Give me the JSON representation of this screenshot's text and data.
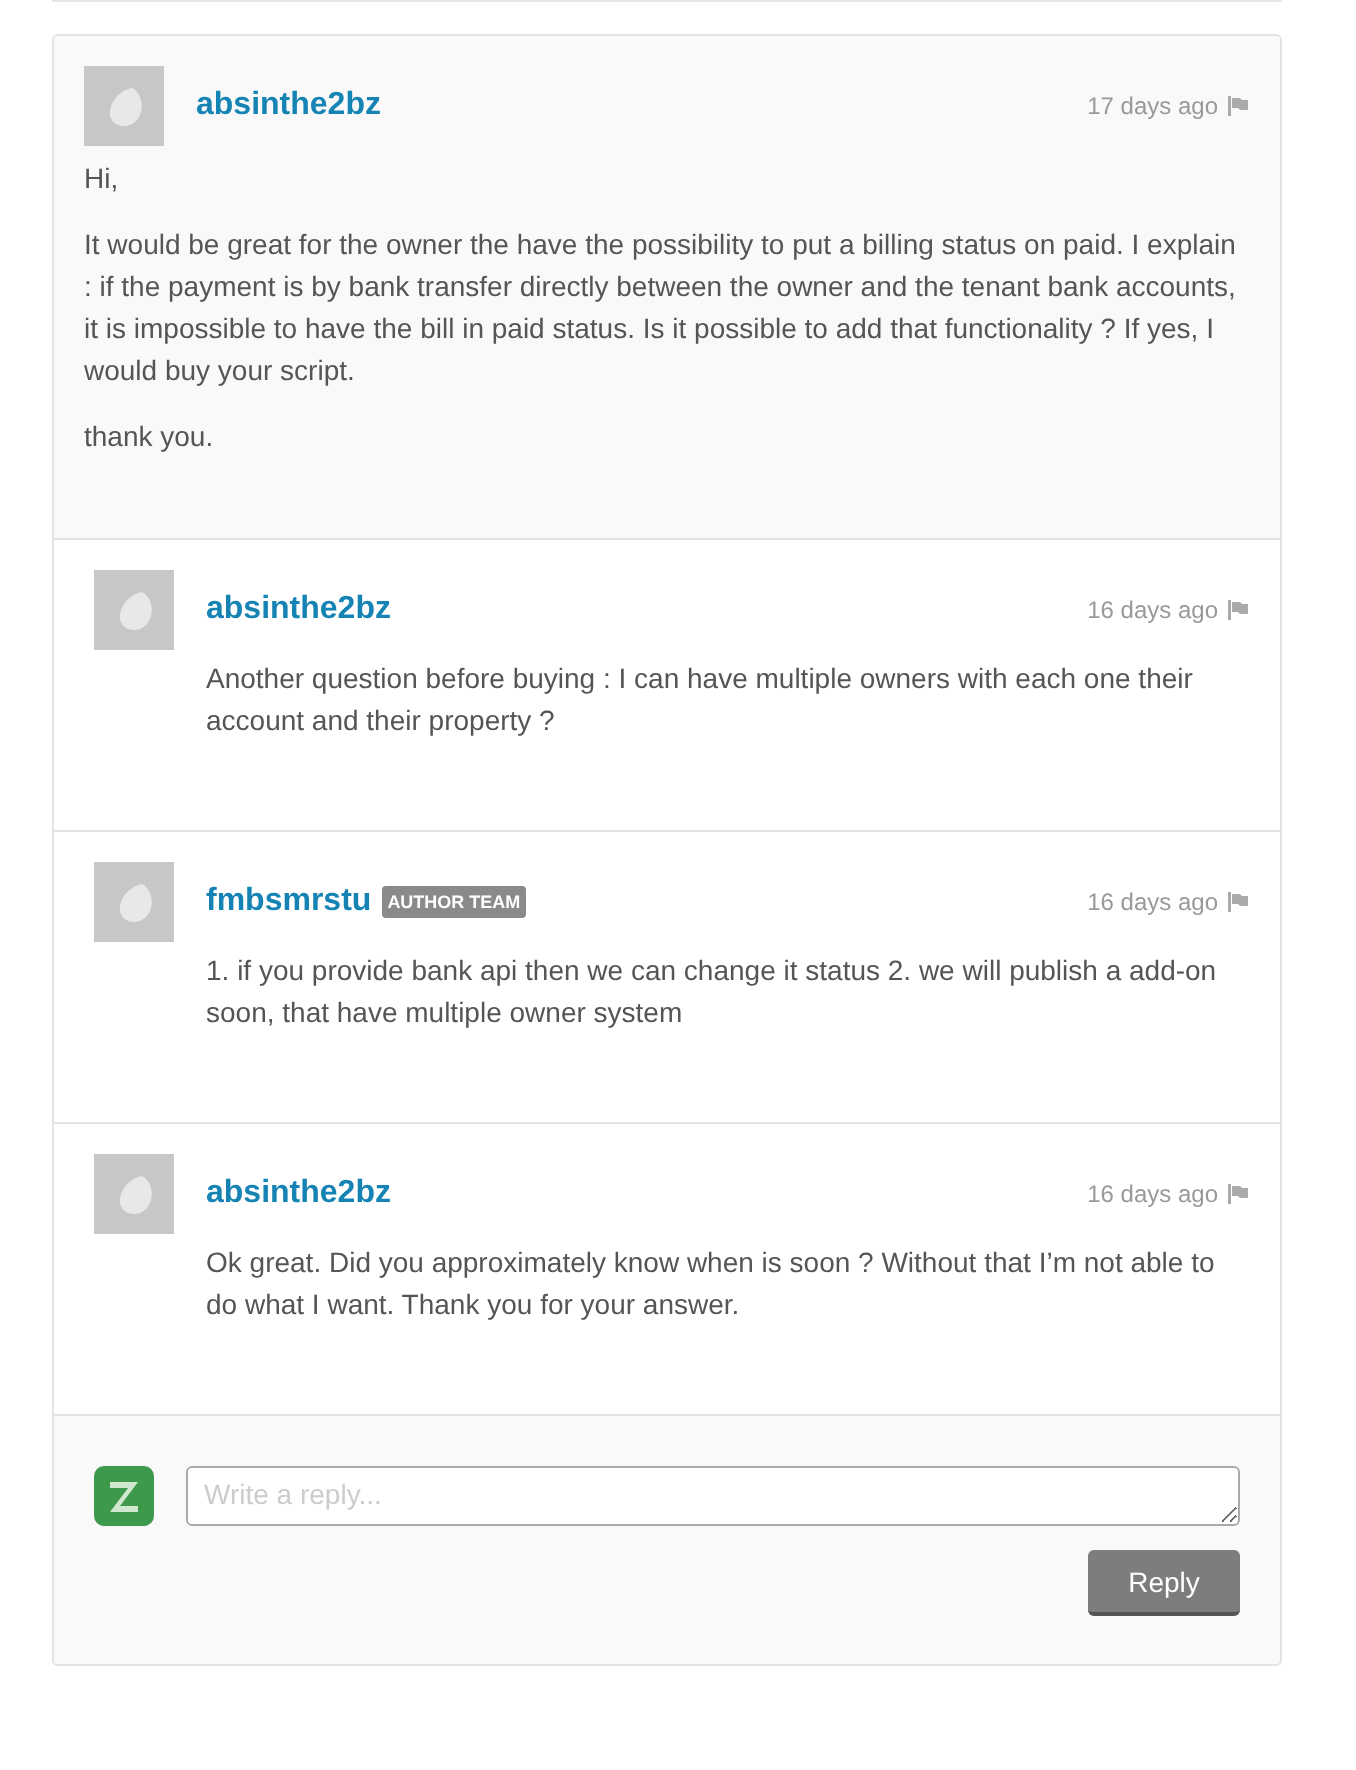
{
  "comment": {
    "author": "absinthe2bz",
    "time": "17 days ago",
    "paragraphs": [
      "Hi,",
      "It would be great for the owner the have the possibility to put a billing status on paid. I explain : if the payment is by bank transfer directly between the owner and the tenant bank accounts, it is impossible to have the bill in paid status. Is it possible to add that functionality ? If yes, I would buy your script.",
      "thank you."
    ]
  },
  "replies": [
    {
      "author": "absinthe2bz",
      "time": "16 days ago",
      "text": "Another question before buying : I can have multiple owners with each one their account and their property ?"
    },
    {
      "author": "fmbsmrstu",
      "badge": "AUTHOR TEAM",
      "time": "16 days ago",
      "text": "1. if you provide bank api then we can change it status 2. we will publish a add-on soon, that have multiple owner system"
    },
    {
      "author": "absinthe2bz",
      "time": "16 days ago",
      "text": "Ok great. Did you approximately know when is soon ? Without that I’m not able to do what I want. Thank you for your answer."
    }
  ],
  "reply_form": {
    "placeholder": "Write a reply...",
    "button": "Reply"
  }
}
